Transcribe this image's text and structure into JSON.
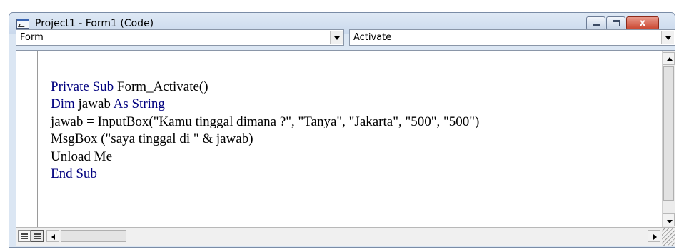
{
  "window": {
    "title": "Project1 - Form1 (Code)",
    "close_glyph": "x"
  },
  "object_combo": {
    "value": "Form"
  },
  "procedure_combo": {
    "value": "Activate"
  },
  "code": {
    "lines": [
      {
        "keyword": "Private Sub",
        "rest": " Form_Activate()"
      },
      {
        "keyword": "Dim",
        "rest": " jawab ",
        "keyword2": "As String"
      },
      {
        "keyword": "",
        "rest": "jawab = InputBox(\"Kamu tinggal dimana ?\", \"Tanya\", \"Jakarta\", \"500\", \"500\")"
      },
      {
        "keyword": "",
        "rest": "MsgBox (\"saya tinggal di \" & jawab)"
      },
      {
        "keyword": "",
        "rest": "Unload Me"
      },
      {
        "keyword": "End Sub",
        "rest": ""
      }
    ]
  },
  "icons": {
    "app": "vb-code-window-icon",
    "minimize": "minimize-icon",
    "maximize": "maximize-icon",
    "close": "close-icon",
    "view_procedure": "procedure-view-icon",
    "view_full": "full-module-view-icon"
  },
  "colors": {
    "keyword": "#00007f",
    "titlebar": "#c9d8ec",
    "close_button": "#c9452e"
  }
}
